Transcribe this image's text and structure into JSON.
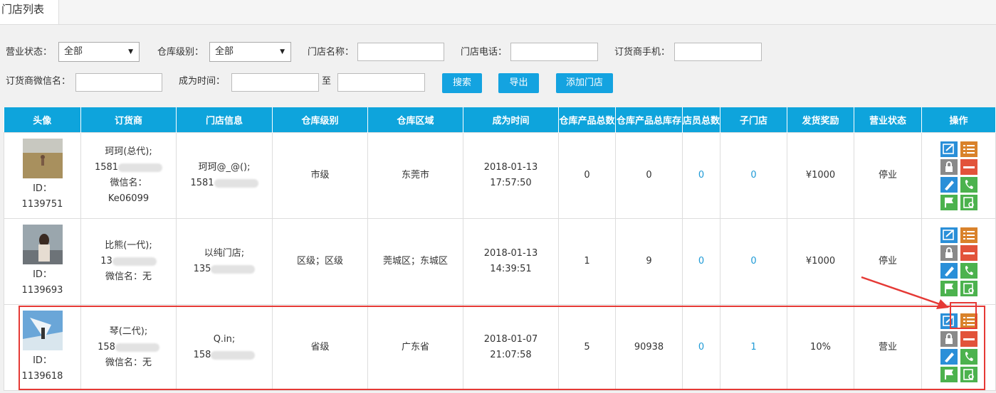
{
  "tab": {
    "label": "门店列表"
  },
  "filters": {
    "status_label": "营业状态：",
    "status_value": "全部",
    "level_label": "仓库级别：",
    "level_value": "全部",
    "store_name_label": "门店名称：",
    "store_phone_label": "门店电话：",
    "dealer_phone_label": "订货商手机：",
    "dealer_wechat_label": "订货商微信名：",
    "time_label": "成为时间：",
    "to_label": "至",
    "search_btn": "搜索",
    "export_btn": "导出",
    "add_btn": "添加门店"
  },
  "table": {
    "headers": [
      "头像",
      "订货商",
      "门店信息",
      "仓库级别",
      "仓库区域",
      "成为时间",
      "仓库产品总数",
      "仓库产品总库存",
      "店员总数",
      "子门店",
      "发货奖励",
      "营业状态",
      "操作"
    ],
    "rows": [
      {
        "id_label": "ID：",
        "id": "1139751",
        "dealer_name": "珂珂(总代);",
        "dealer_phone": "1581",
        "dealer_wechat": "微信名：",
        "dealer_wechat2": "Ke06099",
        "store_name": "珂珂@_@();",
        "store_phone": "1581",
        "level": "市级",
        "area": "东莞市",
        "date": "2018-01-13",
        "time": "17:57:50",
        "products": "0",
        "stock": "0",
        "staff": "0",
        "sub_stores": "0",
        "reward": "¥1000",
        "status": "停业"
      },
      {
        "id_label": "ID：",
        "id": "1139693",
        "dealer_name": "比熊(一代);",
        "dealer_phone": "13",
        "dealer_wechat": "微信名：无",
        "dealer_wechat2": "",
        "store_name": "以纯门店;",
        "store_phone": "135",
        "level": "区级；区级",
        "area": "莞城区；东城区",
        "date": "2018-01-13",
        "time": "14:39:51",
        "products": "1",
        "stock": "9",
        "staff": "0",
        "sub_stores": "0",
        "reward": "¥1000",
        "status": "停业"
      },
      {
        "id_label": "ID：",
        "id": "1139618",
        "dealer_name": "琴(二代);",
        "dealer_phone": "158",
        "dealer_wechat": "微信名：无",
        "dealer_wechat2": "",
        "store_name": "Q.in;",
        "store_phone": "158",
        "level": "省级",
        "area": "广东省",
        "date": "2018-01-07",
        "time": "21:07:58",
        "products": "5",
        "stock": "90938",
        "staff": "0",
        "sub_stores": "1",
        "reward": "10%",
        "status": "营业"
      }
    ]
  },
  "colors": {
    "header_bg": "#0ea4dc",
    "button_bg": "#14a3e0",
    "link": "#1e9ad6",
    "highlight": "#e53935",
    "icon_blue": "#2a8fd8",
    "icon_orange": "#d9822b",
    "icon_gray": "#8a8a8a",
    "icon_red": "#e2533a",
    "icon_green": "#4cb24e"
  },
  "icons": [
    "edit-icon",
    "list-icon",
    "lock-icon",
    "minus-icon",
    "pencil-icon",
    "phone-icon",
    "flag-icon",
    "report-icon"
  ]
}
